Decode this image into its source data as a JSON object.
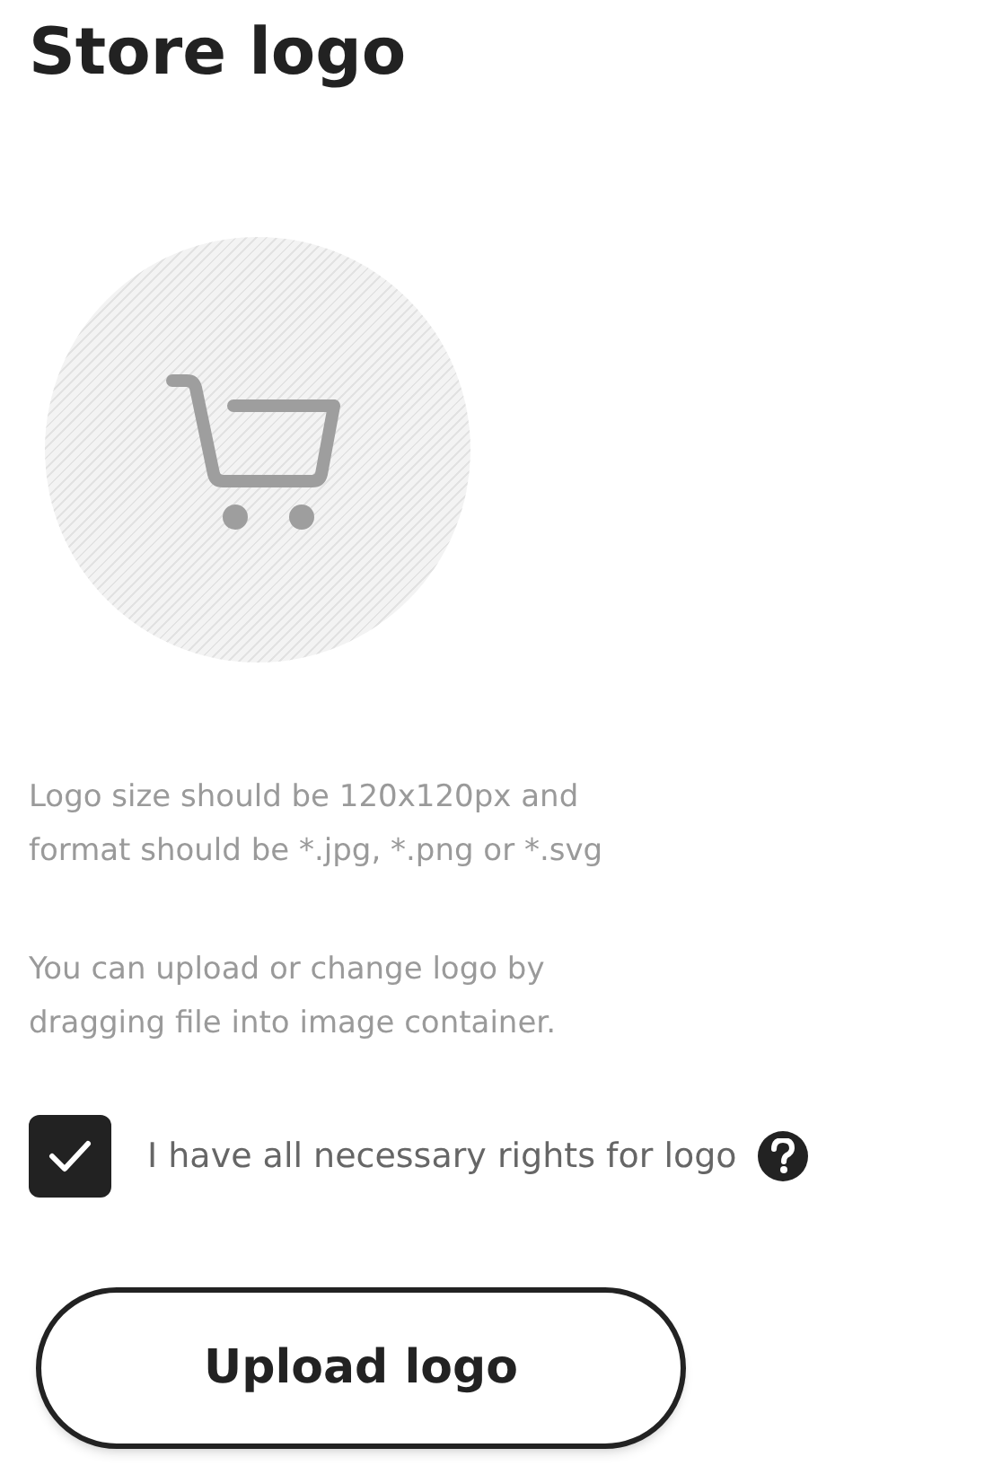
{
  "title": "Store logo",
  "hints": [
    "Logo size should be 120x120px and format should be *.jpg, *.png or *.svg",
    "You can upload or change logo by dragging file into image container."
  ],
  "rights_checkbox": {
    "label": "I have all necessary rights for logo",
    "checked": true
  },
  "button": {
    "label": "Upload logo"
  }
}
